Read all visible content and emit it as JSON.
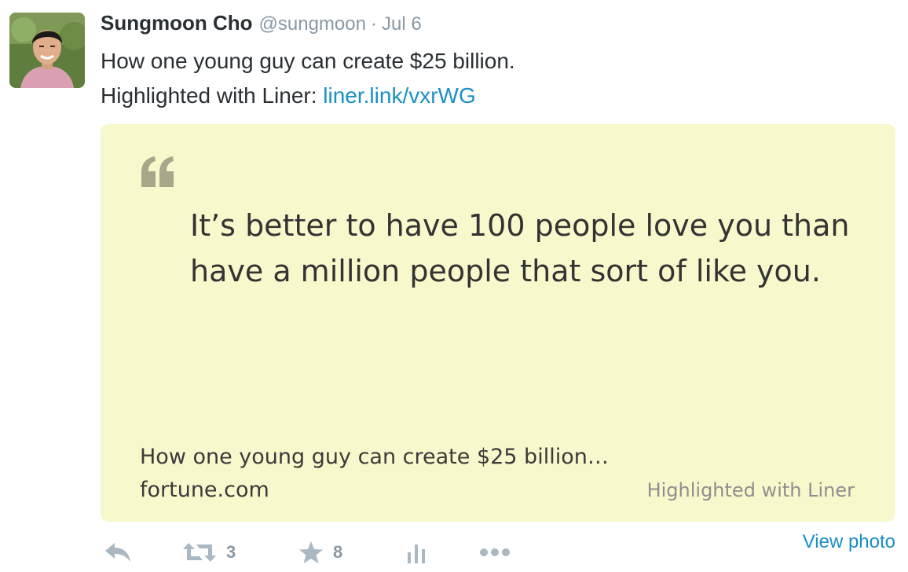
{
  "tweet": {
    "author_name": "Sungmoon Cho",
    "handle": "@sungmoon",
    "separator": "·",
    "date": "Jul 6",
    "line1": "How one young guy can create $25 billion.",
    "line2_prefix": "Highlighted with Liner: ",
    "link_text": "liner.link/vxrWG"
  },
  "card": {
    "quote_text": "It’s better to have 100 people love you than have a million people that sort of like you.",
    "source_title": "How one young guy can create $25 billion…",
    "source_domain": "fortune.com",
    "watermark": "Highlighted with Liner",
    "background_color": "#f7f9cc"
  },
  "actions": {
    "reply_icon": "reply-icon",
    "retweet_icon": "retweet-icon",
    "retweet_count": "3",
    "favorite_icon": "star-icon",
    "favorite_count": "8",
    "analytics_icon": "bar-chart-icon",
    "more_icon": "more-dots-icon",
    "view_photo_label": "View photo"
  },
  "colors": {
    "link": "#1a8fc4",
    "muted": "#8899a6",
    "icon": "#aab8c2",
    "text": "#292f33"
  }
}
